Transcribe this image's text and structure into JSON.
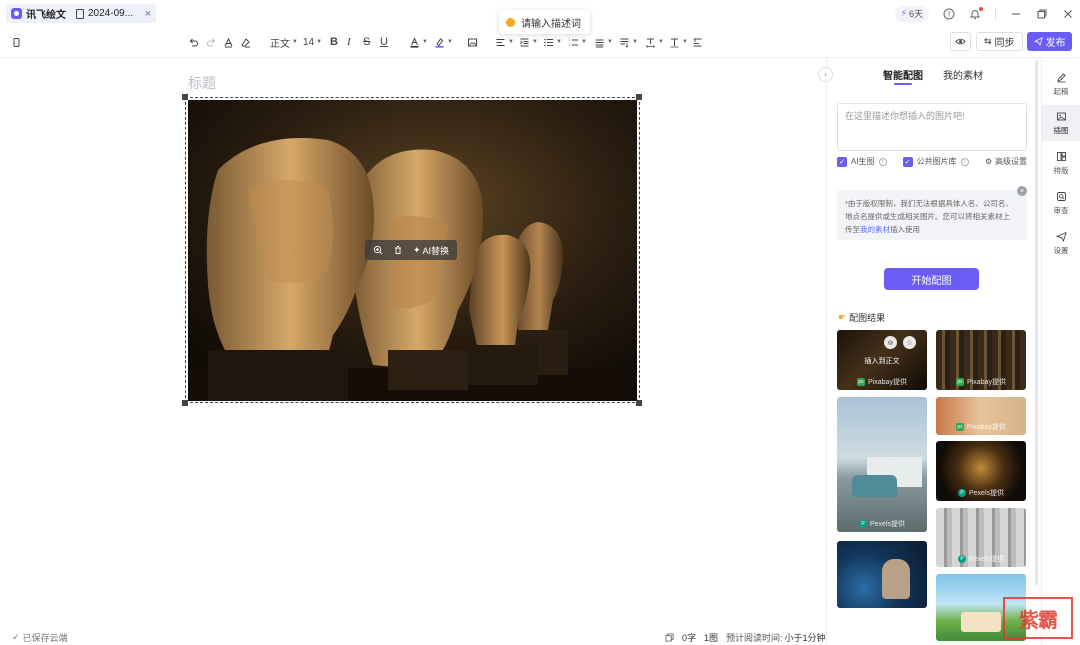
{
  "titlebar": {
    "app_name": "讯飞绘文",
    "doc_tab": "2024-09...",
    "days": "6天"
  },
  "toast": {
    "text": "请输入描述词"
  },
  "toolbar": {
    "style": "正文",
    "font_size": "14",
    "sync": "同步",
    "publish": "发布"
  },
  "editor": {
    "title_placeholder": "标题",
    "ai_replace": "AI替换"
  },
  "footer": {
    "saved": "已保存云端",
    "words": "0字",
    "images": "1图",
    "reading_label": "预计阅读时间:",
    "reading_value": "小于1分钟"
  },
  "panel": {
    "tabs": [
      "智能配图",
      "我的素材"
    ],
    "description_placeholder": "在这里描述你想插入的图片吧!",
    "opt_ai": "AI生图",
    "opt_library": "公共图片库",
    "advanced": "高级设置",
    "notice_1": "*由于版权限制，我们无法根据具体人名、公司名、",
    "notice_2": "地点名提供或生成相关图片。您可以将相关素材上",
    "notice_3a": "传至",
    "notice_link": "我的素材",
    "notice_3b": "插入使用",
    "start": "开始配图",
    "results": "配图结果",
    "insert_label": "插入到正文",
    "credits": {
      "pixabay": "Pixabay提供",
      "pexels": "Pexels提供"
    }
  },
  "rnav": {
    "items": [
      "起稿",
      "插图",
      "排版",
      "审查",
      "设置"
    ]
  },
  "watermark": "紫霸"
}
